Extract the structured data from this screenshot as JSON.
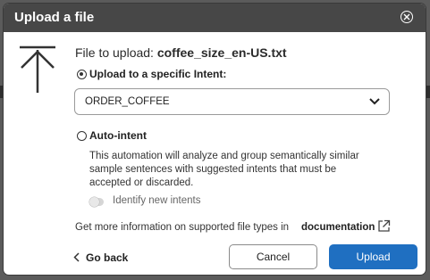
{
  "dialog": {
    "title": "Upload a file",
    "close_icon": "close-circle-icon",
    "upload_icon": "upload-arrow-icon"
  },
  "file": {
    "label": "File to upload:",
    "name": "coffee_size_en-US.txt"
  },
  "options": {
    "specific_intent": {
      "label": "Upload to a specific Intent:",
      "checked": true,
      "selected_value": "ORDER_COFFEE"
    },
    "auto_intent": {
      "label": "Auto-intent",
      "checked": false,
      "description": "This automation will analyze and group semantically similar sample sentences with suggested intents that must be accepted or discarded.",
      "toggle_label": "Identify new intents",
      "toggle_on": false
    }
  },
  "info": {
    "text": "Get more information on supported file types in",
    "link": "documentation"
  },
  "footer": {
    "back": "Go back",
    "cancel": "Cancel",
    "upload": "Upload"
  },
  "colors": {
    "primary": "#1f6fc1",
    "titlebar": "#474747"
  }
}
